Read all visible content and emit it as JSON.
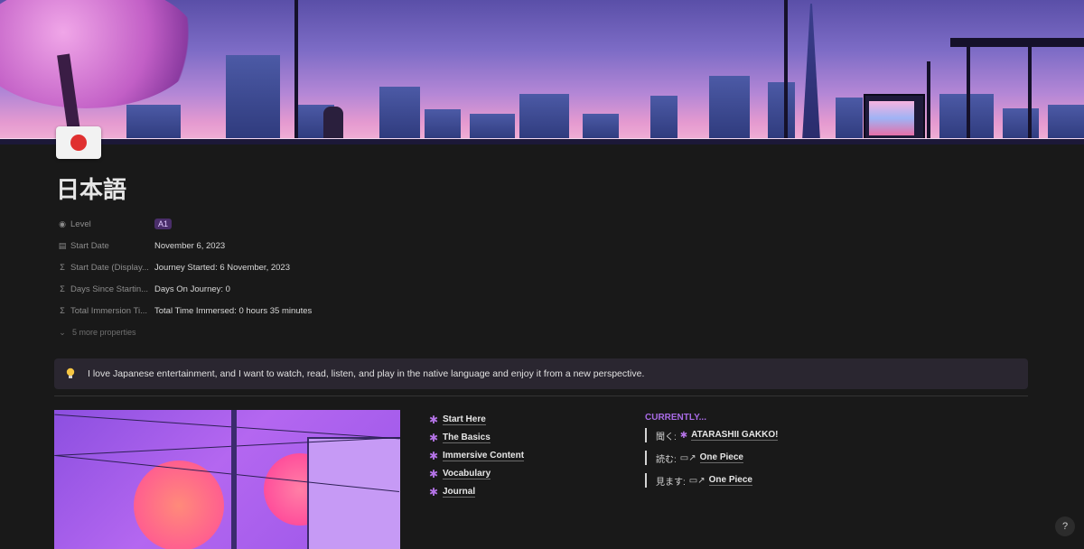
{
  "page": {
    "title": "日本語",
    "icon": "japan-flag-icon"
  },
  "properties": [
    {
      "name": "Level",
      "icon": "status-icon",
      "value": "A1",
      "type": "badge"
    },
    {
      "name": "Start Date",
      "icon": "calendar-icon",
      "value": "November 6, 2023"
    },
    {
      "name": "Start Date (Display...",
      "icon": "formula-icon",
      "value": "Journey Started: 6 November, 2023"
    },
    {
      "name": "Days Since Startin...",
      "icon": "formula-icon",
      "value": "Days On Journey: 0"
    },
    {
      "name": "Total Immersion Ti...",
      "icon": "formula-icon",
      "value": "Total Time Immersed: 0 hours 35 minutes"
    }
  ],
  "more_properties": "5 more properties",
  "callout": {
    "icon": "lightbulb-icon",
    "text": "I love Japanese entertainment, and I want to watch, read, listen, and play in the native language and enjoy it from a new perspective."
  },
  "links": [
    {
      "label": "Start Here"
    },
    {
      "label": "The Basics"
    },
    {
      "label": "Immersive Content"
    },
    {
      "label": "Vocabulary"
    },
    {
      "label": "Journal"
    }
  ],
  "currently": {
    "heading": "CURRENTLY...",
    "items": [
      {
        "prefix": "聞く:",
        "icon": "sparkle-icon",
        "value": "ATARASHII GAKKO!"
      },
      {
        "prefix": "読む:",
        "icon": "page-link-icon",
        "value": "One Piece"
      },
      {
        "prefix": "見ます:",
        "icon": "page-link-icon",
        "value": "One Piece"
      }
    ]
  },
  "help_label": "?",
  "colors": {
    "background": "#191919",
    "accent_purple": "#a96be6",
    "badge_bg": "#4a2e6a",
    "callout_bg": "#2a2630"
  }
}
